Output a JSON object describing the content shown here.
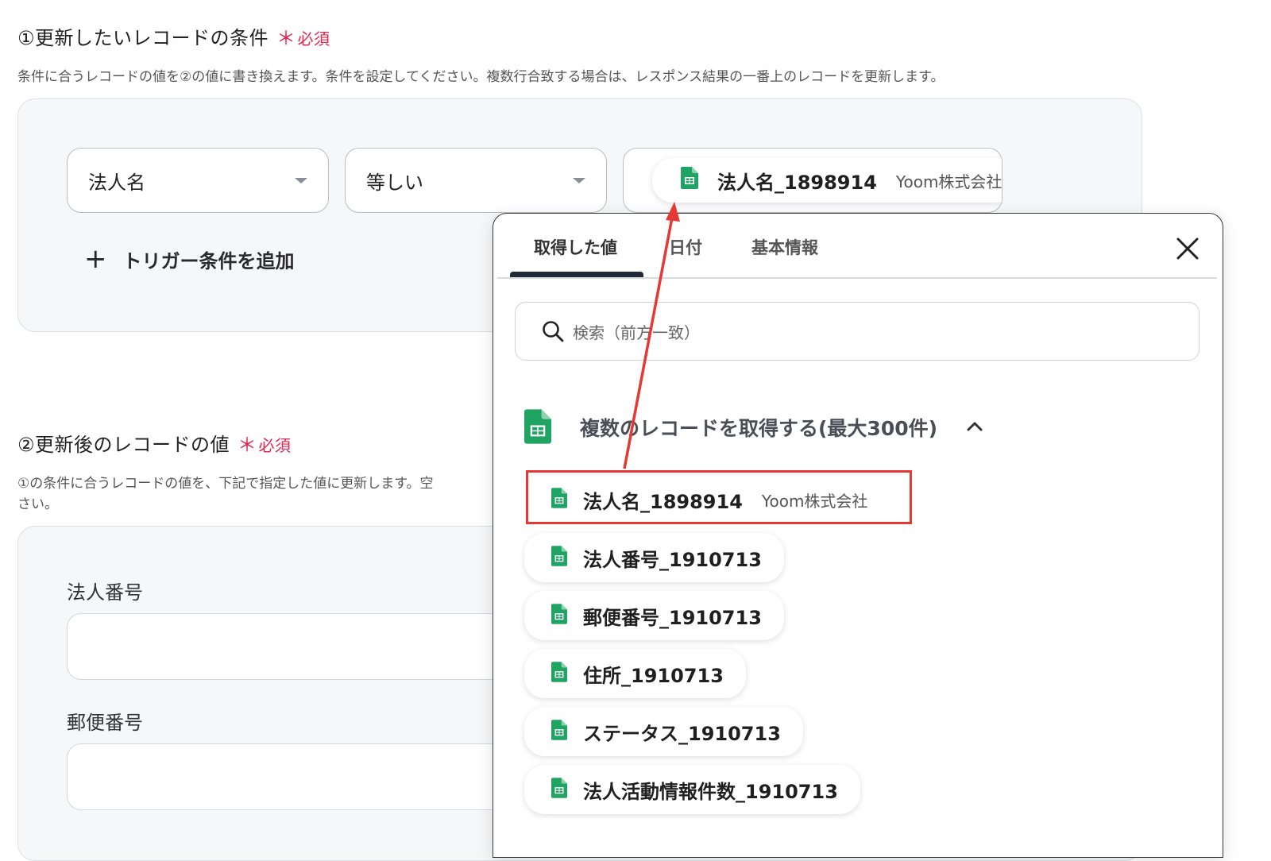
{
  "section1": {
    "title": "①更新したいレコードの条件",
    "required_star": "＊",
    "required_text": "必須",
    "description": "条件に合うレコードの値を②の値に書き換えます。条件を設定してください。複数行合致する場合は、レスポンス結果の一番上のレコードを更新します。"
  },
  "condition": {
    "field_select": "法人名",
    "operator_select": "等しい",
    "value_chip": {
      "name": "法人名_1898914",
      "value": "Yoom株式会社"
    },
    "add_condition": "トリガー条件を追加"
  },
  "section2": {
    "title": "②更新後のレコードの値",
    "required_star": "＊",
    "required_text": "必須",
    "description_line1": "①の条件に合うレコードの値を、下記で指定した値に更新します。空",
    "description_line2": "さい。"
  },
  "fields": [
    {
      "label": "法人番号",
      "value": ""
    },
    {
      "label": "郵便番号",
      "value": ""
    }
  ],
  "popup": {
    "tabs": [
      "取得した値",
      "日付",
      "基本情報"
    ],
    "active_tab": "取得した値",
    "search_placeholder": "検索（前方一致）",
    "group_title": "複数のレコードを取得する(最大300件)",
    "items": [
      {
        "name": "法人名_1898914",
        "value": "Yoom株式会社",
        "highlighted": true
      },
      {
        "name": "法人番号_1910713",
        "value": ""
      },
      {
        "name": "郵便番号_1910713",
        "value": ""
      },
      {
        "name": "住所_1910713",
        "value": ""
      },
      {
        "name": "ステータス_1910713",
        "value": ""
      },
      {
        "name": "法人活動情報件数_1910713",
        "value": ""
      }
    ]
  },
  "colors": {
    "required": "#e5244f",
    "sheet_green": "#1fa463",
    "highlight_red": "#e53935",
    "tab_underline": "#1f2937"
  }
}
